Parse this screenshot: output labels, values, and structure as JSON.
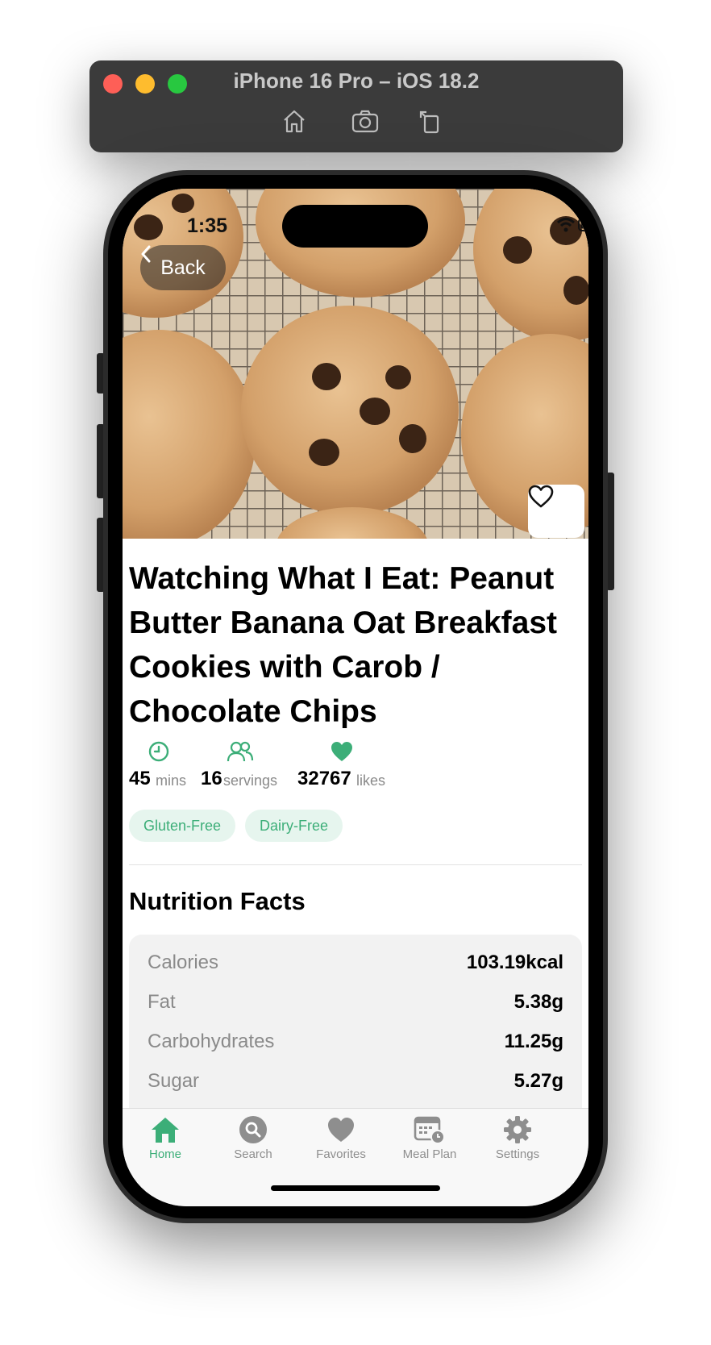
{
  "simulator": {
    "title": "iPhone 16 Pro – iOS 18.2",
    "tools": [
      "home-icon",
      "screenshot-icon",
      "rotate-icon"
    ]
  },
  "status_bar": {
    "time": "1:35"
  },
  "back_label": "Back",
  "recipe": {
    "title": "Watching What I Eat: Peanut Butter Banana Oat Breakfast Cookies with Carob / Chocolate Chips",
    "stats": {
      "time_value": "45",
      "time_unit": "mins",
      "servings_value": "16",
      "servings_unit": "servings",
      "likes_value": "32767",
      "likes_unit": "likes"
    },
    "tags": [
      "Gluten-Free",
      "Dairy-Free"
    ]
  },
  "nutrition": {
    "title": "Nutrition Facts",
    "rows": [
      {
        "label": "Calories",
        "value": "103.19kcal"
      },
      {
        "label": "Fat",
        "value": "5.38g"
      },
      {
        "label": "Carbohydrates",
        "value": "11.25g"
      },
      {
        "label": "Sugar",
        "value": "5.27g"
      }
    ]
  },
  "tabbar": {
    "active": "Home",
    "items": [
      {
        "label": "Home",
        "icon": "home-icon"
      },
      {
        "label": "Search",
        "icon": "search-icon"
      },
      {
        "label": "Favorites",
        "icon": "heart-icon"
      },
      {
        "label": "Meal Plan",
        "icon": "calendar-clock-icon"
      },
      {
        "label": "Settings",
        "icon": "gear-icon"
      }
    ]
  },
  "colors": {
    "accent": "#3cae78",
    "tab_inactive": "#8e8e8e",
    "tag_bg": "#e6f5ee"
  }
}
